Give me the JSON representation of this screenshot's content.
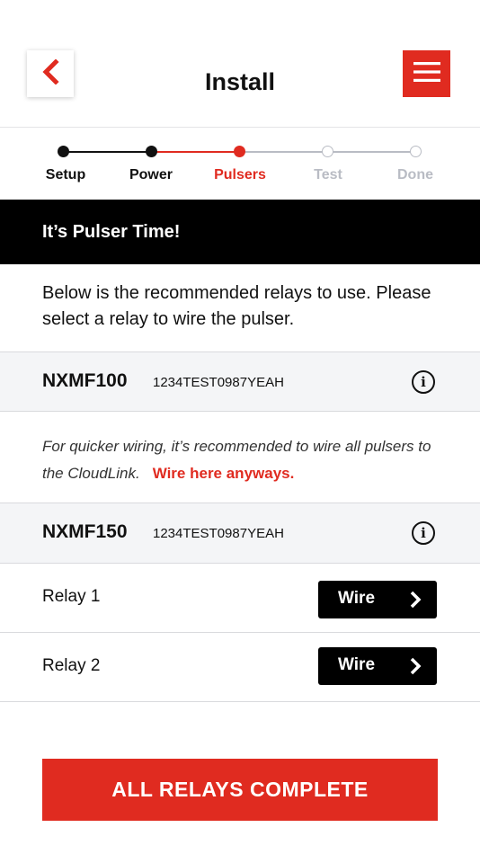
{
  "header": {
    "title": "Install",
    "back_icon": "chevron-left-icon",
    "menu_icon": "hamburger-menu-icon"
  },
  "colors": {
    "accent": "#e02b20",
    "dark": "#111111",
    "muted": "#b9bcc4",
    "row_bg": "#f4f5f7"
  },
  "stepper": {
    "steps": [
      {
        "label": "Setup",
        "state": "done"
      },
      {
        "label": "Power",
        "state": "done"
      },
      {
        "label": "Pulsers",
        "state": "active"
      },
      {
        "label": "Test",
        "state": "todo"
      },
      {
        "label": "Done",
        "state": "todo"
      }
    ]
  },
  "banner": {
    "title": "It’s Pulser Time!"
  },
  "intro": {
    "text": "Below is the recommended relays to use. Please select a relay to wire the pulser."
  },
  "devices": [
    {
      "name": "NXMF100",
      "serial": "1234TEST0987YEAH",
      "info_icon": "info-icon"
    },
    {
      "name": "NXMF150",
      "serial": "1234TEST0987YEAH",
      "info_icon": "info-icon"
    }
  ],
  "tip": {
    "text": "For quicker wiring, it’s recommended to wire all pulsers to the CloudLink.",
    "link": "Wire here anyways."
  },
  "relays": [
    {
      "label": "Relay 1",
      "button": "Wire",
      "icon": "chevron-right-icon"
    },
    {
      "label": "Relay 2",
      "button": "Wire",
      "icon": "chevron-right-icon"
    }
  ],
  "footer": {
    "complete_label": "ALL RELAYS COMPLETE"
  }
}
